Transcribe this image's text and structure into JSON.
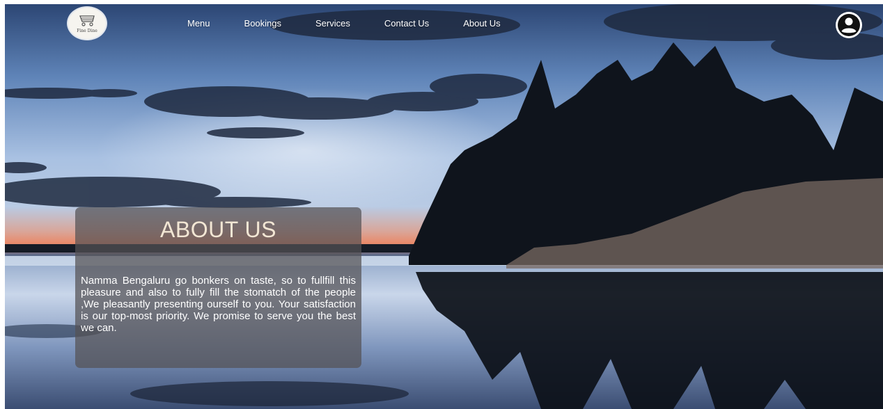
{
  "brand": {
    "logo_text": "Fine Dine"
  },
  "nav": {
    "items": [
      {
        "label": "Menu"
      },
      {
        "label": "Bookings"
      },
      {
        "label": "Services"
      },
      {
        "label": "Contact Us"
      },
      {
        "label": "About Us"
      }
    ]
  },
  "account": {
    "icon": "user-circle-icon"
  },
  "about": {
    "title": "ABOUT US",
    "text": "Namma Bengaluru go bonkers on taste, so to fullfill this pleasure and also to fully fill the stomatch of the people ,We pleasantly presenting ourself to you. Your satisfaction is our top-most priority. We promise to serve you the best we can."
  },
  "colors": {
    "sky_top": "#2e4a78",
    "sky_mid": "#9fb8dc",
    "sunset": "#e98a6a",
    "card_bg": "#555254",
    "title": "#f2e6d4"
  }
}
